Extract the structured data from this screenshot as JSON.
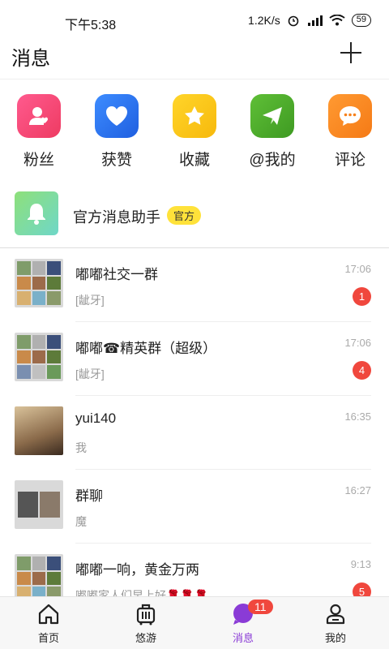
{
  "status_bar": {
    "time": "下午5:38",
    "network_speed": "1.2K/s",
    "battery": "59"
  },
  "header": {
    "title": "消息"
  },
  "quick_actions": [
    {
      "label": "粉丝",
      "icon": "fans-icon",
      "color": "#f04a7a"
    },
    {
      "label": "获赞",
      "icon": "heart-icon",
      "color": "#2f7af0"
    },
    {
      "label": "收藏",
      "icon": "star-icon",
      "color": "#f7c516"
    },
    {
      "label": "@我的",
      "icon": "send-icon",
      "color": "#4ea82c"
    },
    {
      "label": "评论",
      "icon": "comment-icon",
      "color": "#f78a22"
    }
  ],
  "official": {
    "name": "官方消息助手",
    "badge": "官方"
  },
  "chats": [
    {
      "name": "嘟嘟社交一群",
      "time": "17:06",
      "preview": "[龇牙]",
      "unread": "1"
    },
    {
      "name": "嘟嘟☎精英群（超级）",
      "time": "17:06",
      "preview": "[龇牙]",
      "unread": "4"
    },
    {
      "name": "yui140",
      "time": "16:35",
      "preview": "我",
      "unread": ""
    },
    {
      "name": "群聊",
      "time": "16:27",
      "preview": "魔",
      "unread": ""
    },
    {
      "name": "嘟嘟一响，黄金万两",
      "time": "9:13",
      "preview": "嘟嘟家人们早上好🌹🌹🌹",
      "unread": "5"
    }
  ],
  "bottom_nav": [
    {
      "label": "首页",
      "icon": "home-icon"
    },
    {
      "label": "悠游",
      "icon": "luggage-icon"
    },
    {
      "label": "消息",
      "icon": "message-icon",
      "badge": "11",
      "active": true
    },
    {
      "label": "我的",
      "icon": "profile-icon"
    }
  ],
  "colors": {
    "accent": "#8a3bd6",
    "badge": "#f0473d",
    "official_badge": "#ffe23a"
  }
}
